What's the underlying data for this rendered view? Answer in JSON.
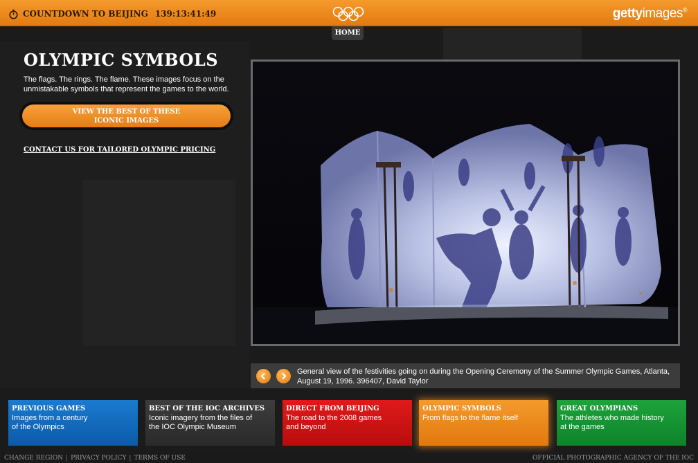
{
  "topbar": {
    "countdown_label": "COUNTDOWN TO BEIJING",
    "countdown_time": "139:13:41:49",
    "brand_bold": "getty",
    "brand_rest": "images",
    "brand_mark": "®",
    "home_label": "HOME"
  },
  "intro": {
    "title": "OLYMPIC SYMBOLS",
    "description": "The flags. The rings. The flame. These images focus on the unmistakable symbols that represent the games to the world.",
    "cta_line1": "VIEW THE BEST OF THESE",
    "cta_line2": "ICONIC IMAGES",
    "contact_link": "CONTACT US FOR TAILORED OLYMPIC PRICING"
  },
  "photo": {
    "caption": "General view of the festivities going on during the Opening Ceremony of the Summer Olympic Games, Atlanta, August 19, 1996. 396407, David Taylor"
  },
  "tiles": [
    {
      "title": "PREVIOUS GAMES",
      "line1": "Images from a century",
      "line2": "of the Olympics"
    },
    {
      "title": "BEST OF THE IOC ARCHIVES",
      "line1": "Iconic imagery from the files of",
      "line2": "the IOC Olympic Museum"
    },
    {
      "title": "DIRECT FROM BEIJING",
      "line1": "The road to the 2008 games",
      "line2": "and beyond"
    },
    {
      "title": "OLYMPIC SYMBOLS",
      "line1": "From flags to the flame itself",
      "line2": ""
    },
    {
      "title": "GREAT OLYMPIANS",
      "line1": "The athletes who made history",
      "line2": "at the games"
    }
  ],
  "footer": {
    "change_region": "CHANGE REGION",
    "privacy_policy": "PRIVACY POLICY",
    "terms": "TERMS OF USE",
    "agency": "OFFICIAL PHOTOGRAPHIC AGENCY OF THE IOC"
  },
  "colors": {
    "accent_orange": "#f0891f",
    "tile_blue": "#1466b8",
    "tile_red": "#c91212",
    "tile_green": "#169133"
  }
}
